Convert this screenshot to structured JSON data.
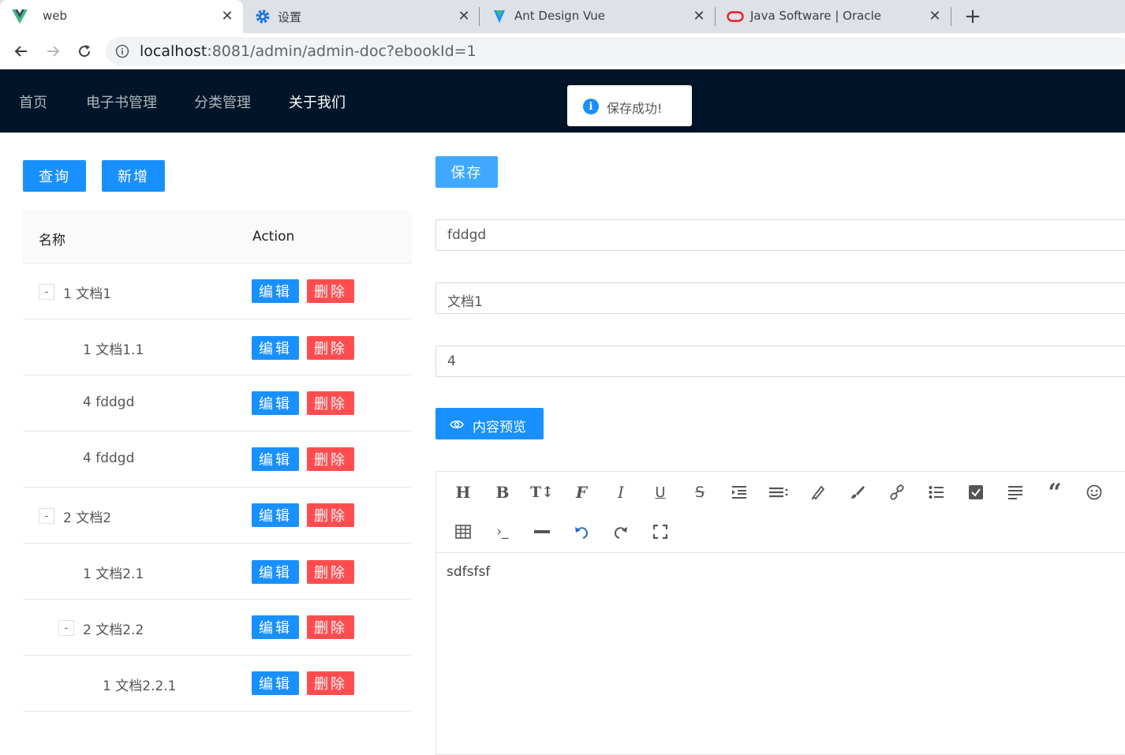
{
  "browser": {
    "tabs": [
      {
        "title": "web",
        "favicon": "vue-logo-icon",
        "active": true
      },
      {
        "title": "设置",
        "favicon": "settings-gear-icon",
        "active": false
      },
      {
        "title": "Ant Design Vue",
        "favicon": "antdv-logo-icon",
        "active": false
      },
      {
        "title": "Java Software | Oracle",
        "favicon": "oracle-logo-icon",
        "active": false
      }
    ],
    "url_host": "localhost",
    "url_rest": ":8081/admin/admin-doc?ebookId=1"
  },
  "header": {
    "menu": [
      "首页",
      "电子书管理",
      "分类管理",
      "关于我们"
    ],
    "active_menu": "关于我们",
    "colors": {
      "background": "#001529"
    }
  },
  "toast": {
    "message": "保存成功!",
    "icon": "info-circle-icon"
  },
  "left": {
    "query_label": "查询",
    "add_label": "新增",
    "columns": [
      "名称",
      "Action"
    ],
    "edit_label": "编辑",
    "delete_label": "删除",
    "rows": [
      {
        "name": "1 文档1",
        "depth": 0,
        "expandable": true,
        "expander": "-"
      },
      {
        "name": "1 文档1.1",
        "depth": 1,
        "expandable": false
      },
      {
        "name": "4 fddgd",
        "depth": 1,
        "expandable": false
      },
      {
        "name": "4 fddgd",
        "depth": 1,
        "expandable": false
      },
      {
        "name": "2 文档2",
        "depth": 0,
        "expandable": true,
        "expander": "-"
      },
      {
        "name": "1 文档2.1",
        "depth": 1,
        "expandable": false
      },
      {
        "name": "2 文档2.2",
        "depth": 1,
        "expandable": true,
        "expander": "-"
      },
      {
        "name": "1 文档2.2.1",
        "depth": 2,
        "expandable": false
      }
    ]
  },
  "right": {
    "save_label": "保存",
    "fields": {
      "name": "fddgd",
      "parent": "文档1",
      "sort": "4"
    },
    "preview_label": "内容预览",
    "editor": {
      "toolbar_icons": [
        "heading-icon",
        "bold-icon",
        "font-size-icon",
        "font-family-icon",
        "italic-icon",
        "underline-icon",
        "strikethrough-icon",
        "indent-icon",
        "align-icon",
        "highlight-icon",
        "paint-brush-icon",
        "link-icon",
        "unordered-list-icon",
        "checkbox-icon",
        "paragraph-icon",
        "quote-icon",
        "emoji-icon",
        "table-icon",
        "code-icon",
        "horizontal-rule-icon",
        "undo-icon",
        "redo-icon",
        "fullscreen-icon"
      ],
      "content": "sdfsfsf"
    }
  }
}
